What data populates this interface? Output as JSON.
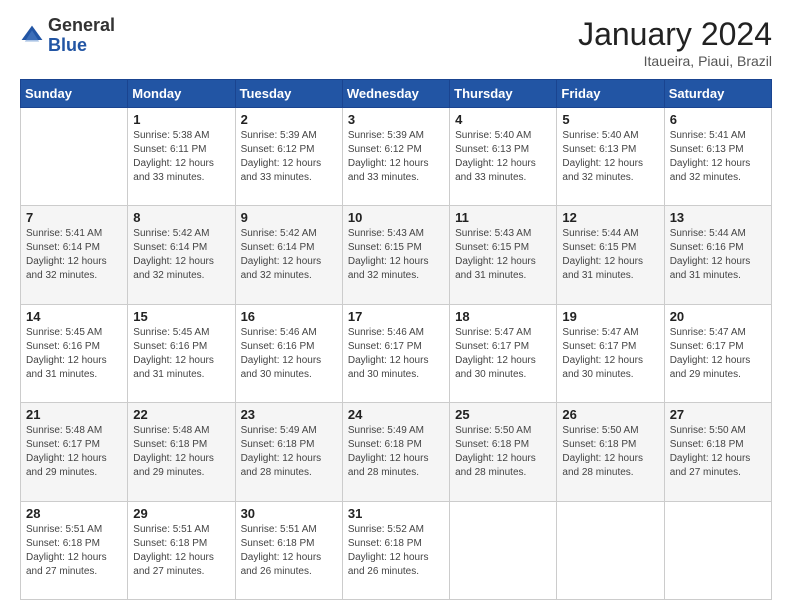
{
  "logo": {
    "general": "General",
    "blue": "Blue"
  },
  "header": {
    "title": "January 2024",
    "subtitle": "Itaueira, Piaui, Brazil"
  },
  "weekdays": [
    "Sunday",
    "Monday",
    "Tuesday",
    "Wednesday",
    "Thursday",
    "Friday",
    "Saturday"
  ],
  "weeks": [
    [
      {
        "day": "",
        "sunrise": "",
        "sunset": "",
        "daylight": ""
      },
      {
        "day": "1",
        "sunrise": "Sunrise: 5:38 AM",
        "sunset": "Sunset: 6:11 PM",
        "daylight": "Daylight: 12 hours and 33 minutes."
      },
      {
        "day": "2",
        "sunrise": "Sunrise: 5:39 AM",
        "sunset": "Sunset: 6:12 PM",
        "daylight": "Daylight: 12 hours and 33 minutes."
      },
      {
        "day": "3",
        "sunrise": "Sunrise: 5:39 AM",
        "sunset": "Sunset: 6:12 PM",
        "daylight": "Daylight: 12 hours and 33 minutes."
      },
      {
        "day": "4",
        "sunrise": "Sunrise: 5:40 AM",
        "sunset": "Sunset: 6:13 PM",
        "daylight": "Daylight: 12 hours and 33 minutes."
      },
      {
        "day": "5",
        "sunrise": "Sunrise: 5:40 AM",
        "sunset": "Sunset: 6:13 PM",
        "daylight": "Daylight: 12 hours and 32 minutes."
      },
      {
        "day": "6",
        "sunrise": "Sunrise: 5:41 AM",
        "sunset": "Sunset: 6:13 PM",
        "daylight": "Daylight: 12 hours and 32 minutes."
      }
    ],
    [
      {
        "day": "7",
        "sunrise": "Sunrise: 5:41 AM",
        "sunset": "Sunset: 6:14 PM",
        "daylight": "Daylight: 12 hours and 32 minutes."
      },
      {
        "day": "8",
        "sunrise": "Sunrise: 5:42 AM",
        "sunset": "Sunset: 6:14 PM",
        "daylight": "Daylight: 12 hours and 32 minutes."
      },
      {
        "day": "9",
        "sunrise": "Sunrise: 5:42 AM",
        "sunset": "Sunset: 6:14 PM",
        "daylight": "Daylight: 12 hours and 32 minutes."
      },
      {
        "day": "10",
        "sunrise": "Sunrise: 5:43 AM",
        "sunset": "Sunset: 6:15 PM",
        "daylight": "Daylight: 12 hours and 32 minutes."
      },
      {
        "day": "11",
        "sunrise": "Sunrise: 5:43 AM",
        "sunset": "Sunset: 6:15 PM",
        "daylight": "Daylight: 12 hours and 31 minutes."
      },
      {
        "day": "12",
        "sunrise": "Sunrise: 5:44 AM",
        "sunset": "Sunset: 6:15 PM",
        "daylight": "Daylight: 12 hours and 31 minutes."
      },
      {
        "day": "13",
        "sunrise": "Sunrise: 5:44 AM",
        "sunset": "Sunset: 6:16 PM",
        "daylight": "Daylight: 12 hours and 31 minutes."
      }
    ],
    [
      {
        "day": "14",
        "sunrise": "Sunrise: 5:45 AM",
        "sunset": "Sunset: 6:16 PM",
        "daylight": "Daylight: 12 hours and 31 minutes."
      },
      {
        "day": "15",
        "sunrise": "Sunrise: 5:45 AM",
        "sunset": "Sunset: 6:16 PM",
        "daylight": "Daylight: 12 hours and 31 minutes."
      },
      {
        "day": "16",
        "sunrise": "Sunrise: 5:46 AM",
        "sunset": "Sunset: 6:16 PM",
        "daylight": "Daylight: 12 hours and 30 minutes."
      },
      {
        "day": "17",
        "sunrise": "Sunrise: 5:46 AM",
        "sunset": "Sunset: 6:17 PM",
        "daylight": "Daylight: 12 hours and 30 minutes."
      },
      {
        "day": "18",
        "sunrise": "Sunrise: 5:47 AM",
        "sunset": "Sunset: 6:17 PM",
        "daylight": "Daylight: 12 hours and 30 minutes."
      },
      {
        "day": "19",
        "sunrise": "Sunrise: 5:47 AM",
        "sunset": "Sunset: 6:17 PM",
        "daylight": "Daylight: 12 hours and 30 minutes."
      },
      {
        "day": "20",
        "sunrise": "Sunrise: 5:47 AM",
        "sunset": "Sunset: 6:17 PM",
        "daylight": "Daylight: 12 hours and 29 minutes."
      }
    ],
    [
      {
        "day": "21",
        "sunrise": "Sunrise: 5:48 AM",
        "sunset": "Sunset: 6:17 PM",
        "daylight": "Daylight: 12 hours and 29 minutes."
      },
      {
        "day": "22",
        "sunrise": "Sunrise: 5:48 AM",
        "sunset": "Sunset: 6:18 PM",
        "daylight": "Daylight: 12 hours and 29 minutes."
      },
      {
        "day": "23",
        "sunrise": "Sunrise: 5:49 AM",
        "sunset": "Sunset: 6:18 PM",
        "daylight": "Daylight: 12 hours and 28 minutes."
      },
      {
        "day": "24",
        "sunrise": "Sunrise: 5:49 AM",
        "sunset": "Sunset: 6:18 PM",
        "daylight": "Daylight: 12 hours and 28 minutes."
      },
      {
        "day": "25",
        "sunrise": "Sunrise: 5:50 AM",
        "sunset": "Sunset: 6:18 PM",
        "daylight": "Daylight: 12 hours and 28 minutes."
      },
      {
        "day": "26",
        "sunrise": "Sunrise: 5:50 AM",
        "sunset": "Sunset: 6:18 PM",
        "daylight": "Daylight: 12 hours and 28 minutes."
      },
      {
        "day": "27",
        "sunrise": "Sunrise: 5:50 AM",
        "sunset": "Sunset: 6:18 PM",
        "daylight": "Daylight: 12 hours and 27 minutes."
      }
    ],
    [
      {
        "day": "28",
        "sunrise": "Sunrise: 5:51 AM",
        "sunset": "Sunset: 6:18 PM",
        "daylight": "Daylight: 12 hours and 27 minutes."
      },
      {
        "day": "29",
        "sunrise": "Sunrise: 5:51 AM",
        "sunset": "Sunset: 6:18 PM",
        "daylight": "Daylight: 12 hours and 27 minutes."
      },
      {
        "day": "30",
        "sunrise": "Sunrise: 5:51 AM",
        "sunset": "Sunset: 6:18 PM",
        "daylight": "Daylight: 12 hours and 26 minutes."
      },
      {
        "day": "31",
        "sunrise": "Sunrise: 5:52 AM",
        "sunset": "Sunset: 6:18 PM",
        "daylight": "Daylight: 12 hours and 26 minutes."
      },
      {
        "day": "",
        "sunrise": "",
        "sunset": "",
        "daylight": ""
      },
      {
        "day": "",
        "sunrise": "",
        "sunset": "",
        "daylight": ""
      },
      {
        "day": "",
        "sunrise": "",
        "sunset": "",
        "daylight": ""
      }
    ]
  ]
}
